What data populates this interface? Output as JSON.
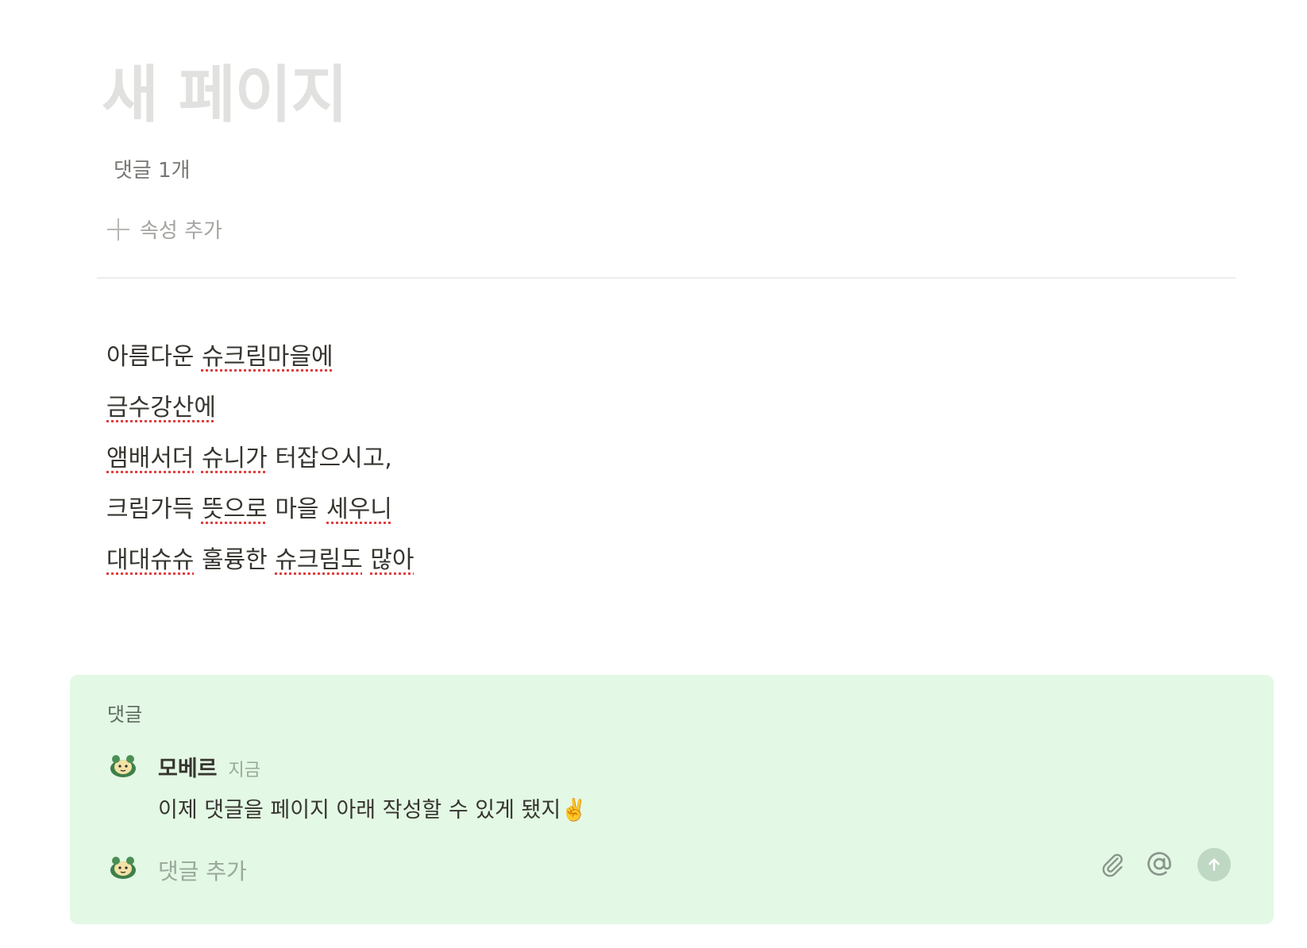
{
  "page": {
    "title": "새 페이지",
    "comment_count": "댓글 1개",
    "add_property_label": "속성 추가"
  },
  "body_lines": [
    [
      "아름다운",
      "슈크림마을에"
    ],
    [
      "금수강산에"
    ],
    [
      "앰배서더",
      "슈니가",
      "터잡으시고,"
    ],
    [
      "크림가득",
      "뜻으로",
      "마을",
      "세우니"
    ],
    [
      "대대슈슈",
      "훌륭한",
      "슈크림도",
      "많아"
    ]
  ],
  "comments": {
    "header": "댓글",
    "items": [
      {
        "author": "모베르",
        "time": "지금",
        "text": "이제 댓글을 페이지 아래 작성할 수 있게 됐지✌️"
      }
    ],
    "input_placeholder": "댓글 추가"
  },
  "icons": {
    "add": "plus-icon",
    "attach": "paperclip-icon",
    "mention": "at-sign-icon",
    "send": "arrow-up-icon",
    "avatar": "turtle-avatar"
  },
  "colors": {
    "comment_panel_bg": "#e3f8e5",
    "title_placeholder": "#e1e1df",
    "spellcheck_underline": "#e03e3e",
    "send_button_bg": "#bfd8c3"
  }
}
